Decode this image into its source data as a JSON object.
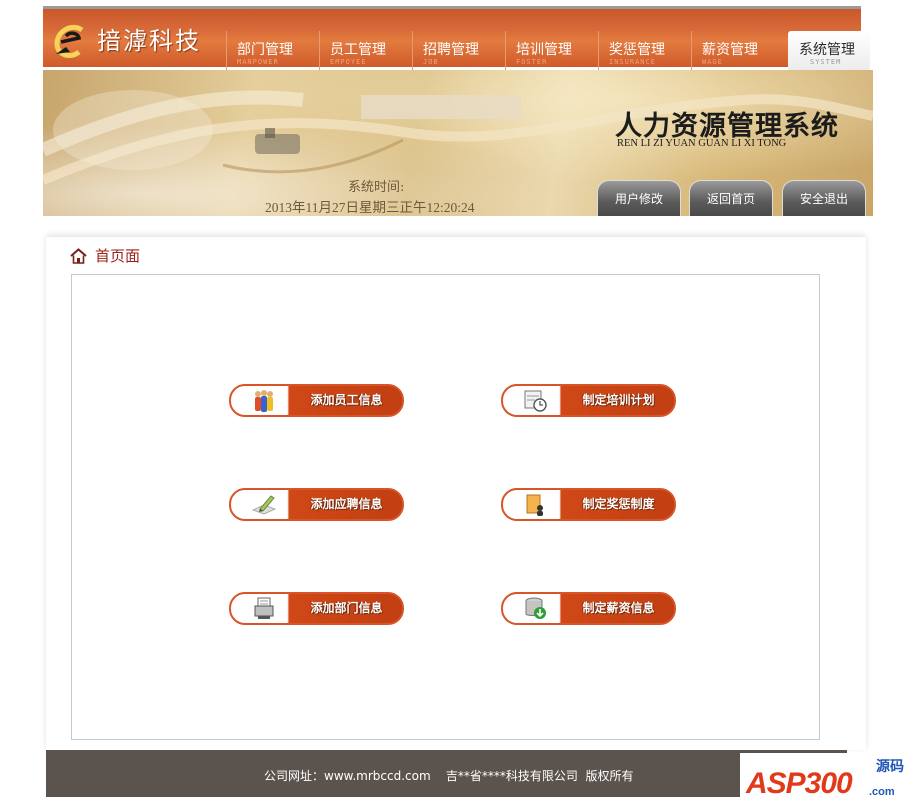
{
  "brand": {
    "name": "揞滹科技",
    "logo_icon": "e-logo-icon"
  },
  "nav": [
    {
      "label": "部门管理",
      "sub": "MANPOWER",
      "active": false
    },
    {
      "label": "员工管理",
      "sub": "EMPOYEE",
      "active": false
    },
    {
      "label": "招聘管理",
      "sub": "JOB",
      "active": false
    },
    {
      "label": "培训管理",
      "sub": "FOSTER",
      "active": false
    },
    {
      "label": "奖惩管理",
      "sub": "INSURANCE",
      "active": false
    },
    {
      "label": "薪资管理",
      "sub": "WAGE",
      "active": false
    },
    {
      "label": "系统管理",
      "sub": "SYSTEM",
      "active": true
    }
  ],
  "banner": {
    "title": "人力资源管理系统",
    "pinyin": "REN LI ZI YUAN GUAN LI XI TONG",
    "time_label": "系统时间:",
    "time_value": "2013年11月27日星期三正午12:20:24",
    "buttons": {
      "modify": "用户修改",
      "home": "返回首页",
      "logout": "安全退出"
    }
  },
  "breadcrumb": {
    "icon": "home-icon",
    "label": "首页面"
  },
  "actions": [
    {
      "label": "添加员工信息",
      "icon": "people-icon"
    },
    {
      "label": "制定培训计划",
      "icon": "calendar-clock-icon"
    },
    {
      "label": "添加应聘信息",
      "icon": "pen-paper-icon"
    },
    {
      "label": "制定奖惩制度",
      "icon": "document-user-icon"
    },
    {
      "label": "添加部门信息",
      "icon": "fax-icon"
    },
    {
      "label": "制定薪资信息",
      "icon": "database-download-icon"
    }
  ],
  "footer": {
    "text": "公司网址：www.mrbccd.com    吉**省****科技有限公司  版权所有"
  },
  "watermark": {
    "main": "ASP300",
    "cn": "源码",
    "domain": ".com"
  },
  "colors": {
    "nav_orange": "#d86a38",
    "button_orange": "#c23f12",
    "footer": "#5b544e",
    "breadcrumb": "#9b1f1a"
  }
}
